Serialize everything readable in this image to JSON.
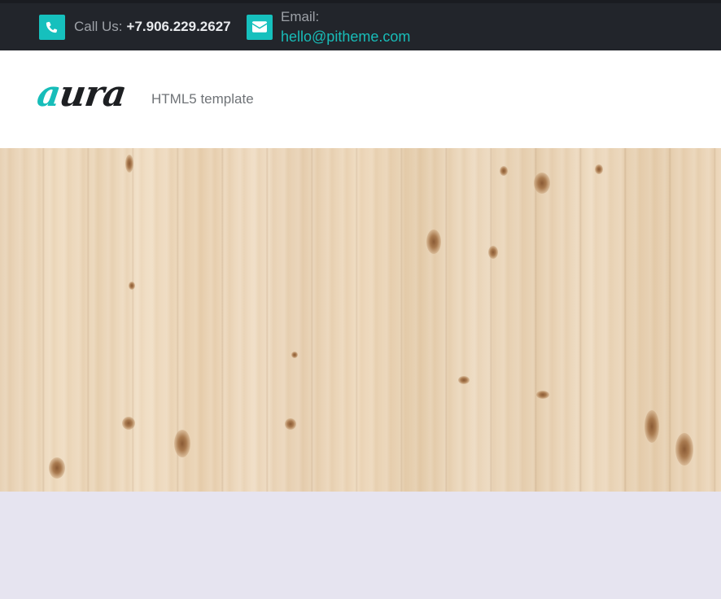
{
  "topbar": {
    "phone": {
      "icon": "phone-icon",
      "label": "Call Us:",
      "value": "+7.906.229.2627"
    },
    "email": {
      "icon": "envelope-icon",
      "label": "Email:",
      "value": "hello@pitheme.com"
    }
  },
  "header": {
    "logo": {
      "first_letter": "a",
      "rest": "ura"
    },
    "tagline": "HTML5 template"
  },
  "hero": {
    "image": "wood-planks-background"
  },
  "colors": {
    "accent": "#16c0bd",
    "topbar_bg": "#22252b",
    "header_bg": "#ffffff",
    "page_bg": "#e6e4f0"
  }
}
